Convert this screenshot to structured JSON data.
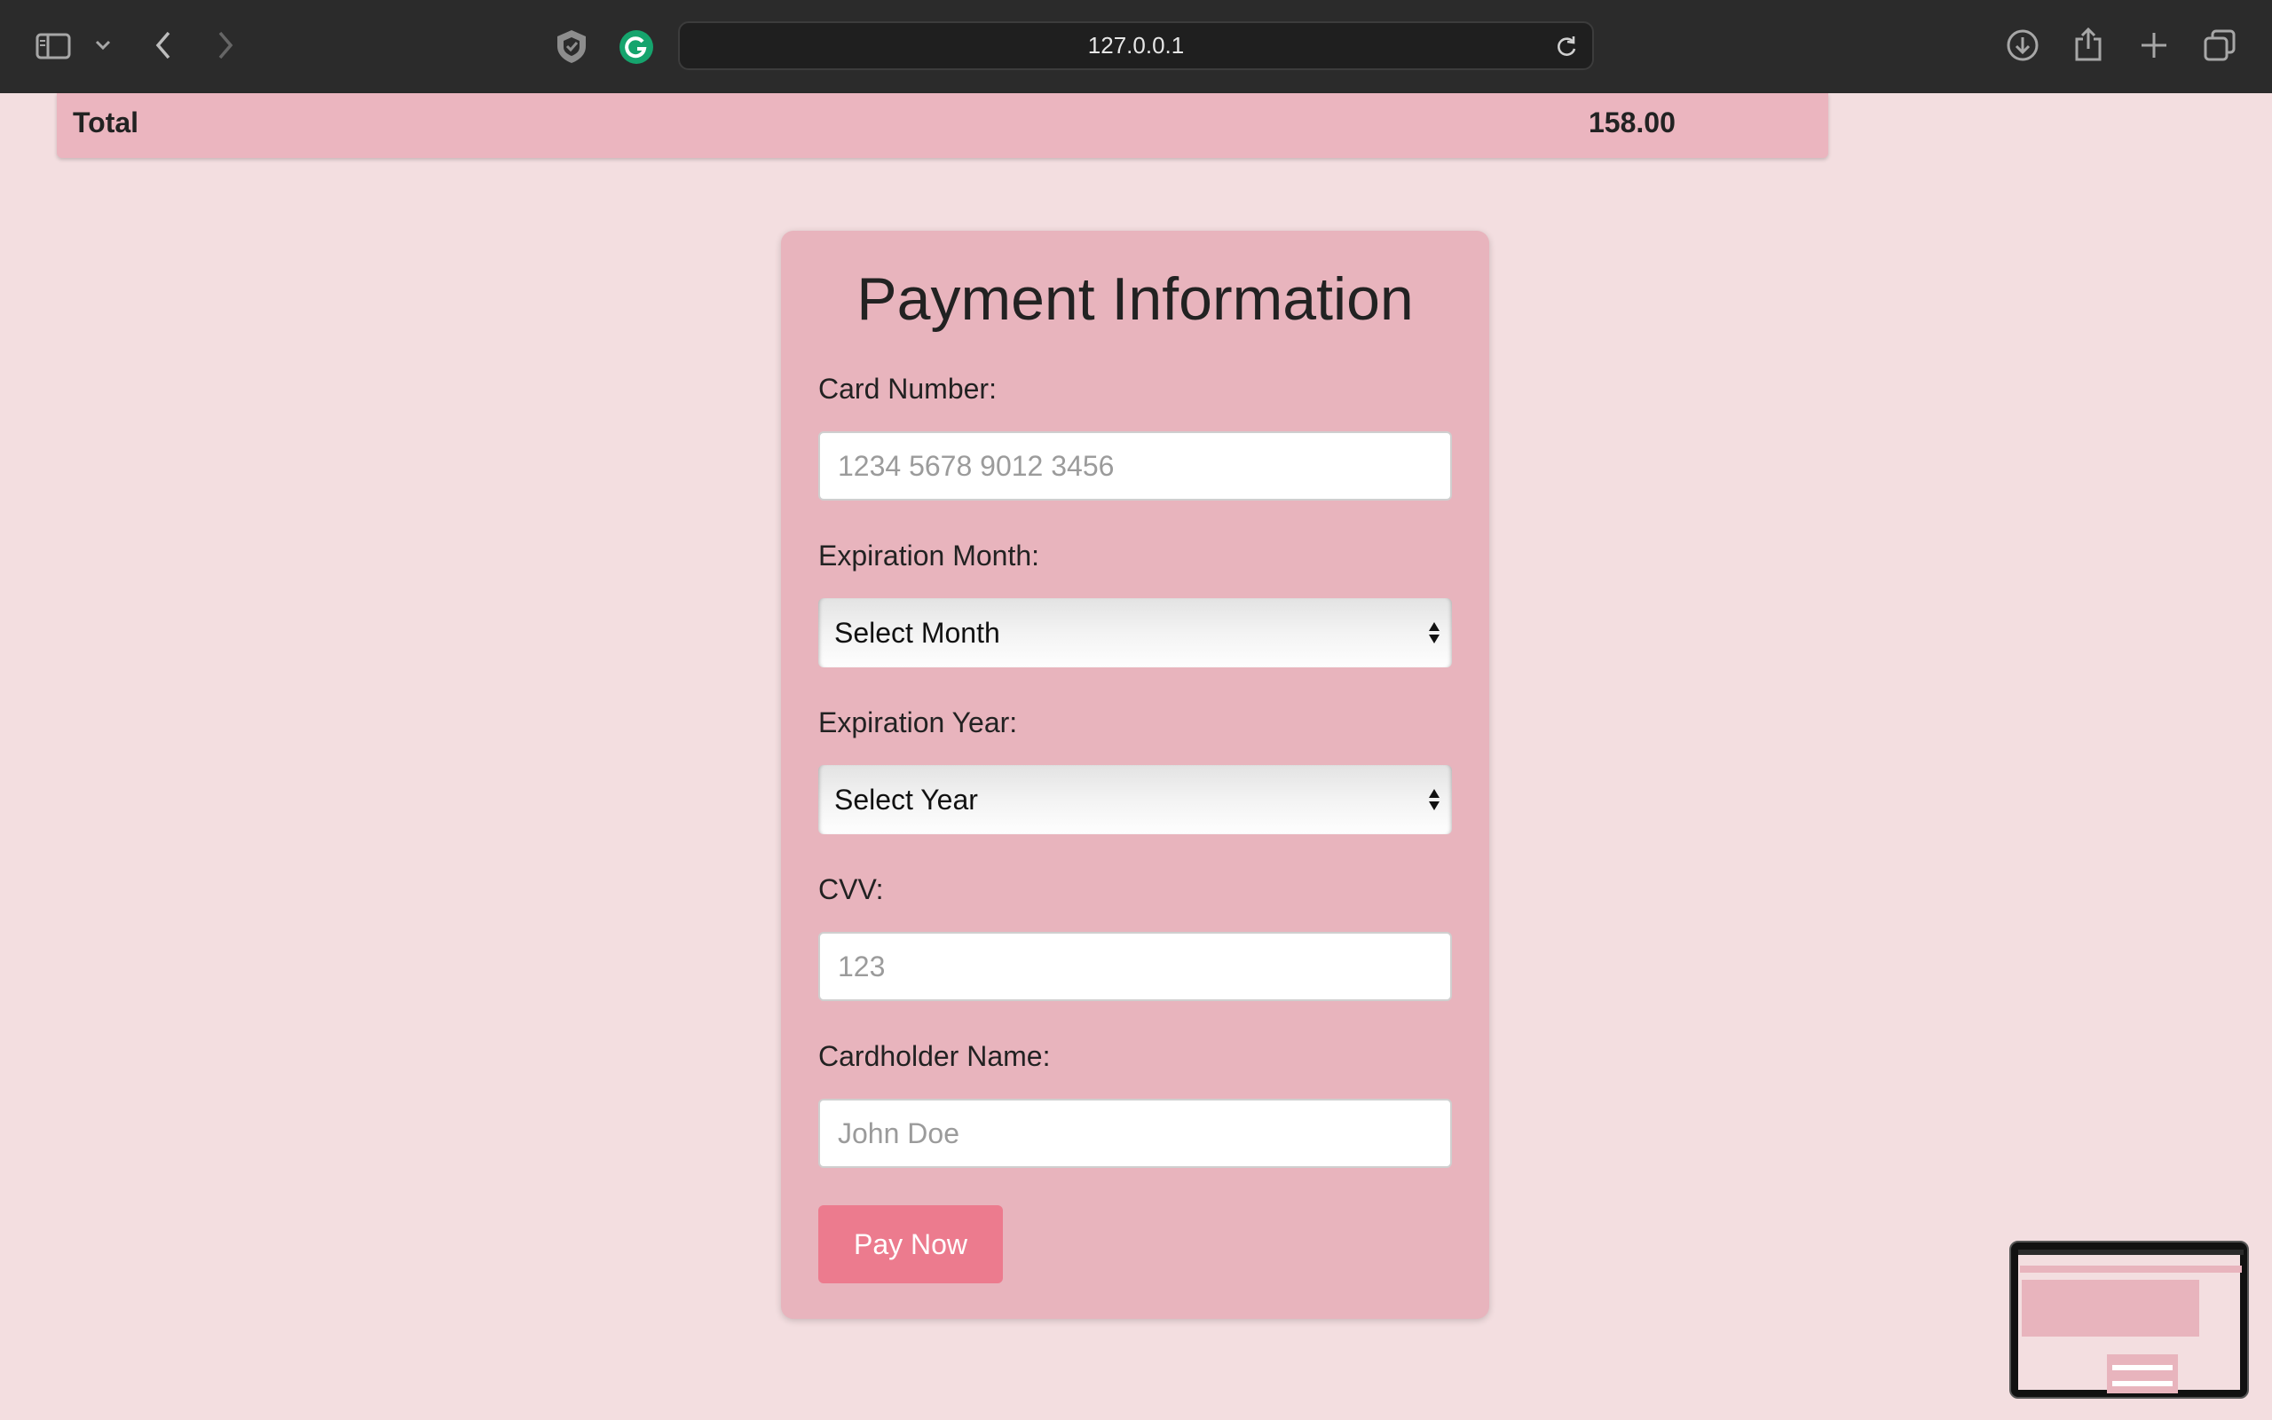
{
  "browser": {
    "url": "127.0.0.1"
  },
  "cart": {
    "total_label": "Total",
    "total_value": "158.00"
  },
  "payment": {
    "title": "Payment Information",
    "card_number_label": "Card Number:",
    "card_number_placeholder": "1234 5678 9012 3456",
    "exp_month_label": "Expiration Month:",
    "exp_month_value": "Select Month",
    "exp_year_label": "Expiration Year:",
    "exp_year_value": "Select Year",
    "cvv_label": "CVV:",
    "cvv_placeholder": "123",
    "name_label": "Cardholder Name:",
    "name_placeholder": "John Doe",
    "pay_button": "Pay Now"
  },
  "colors": {
    "page_bg": "#f3dee0",
    "card_bg": "#e8b4bd",
    "button_bg": "#ec7b8e",
    "chrome_bg": "#2b2b2b"
  }
}
